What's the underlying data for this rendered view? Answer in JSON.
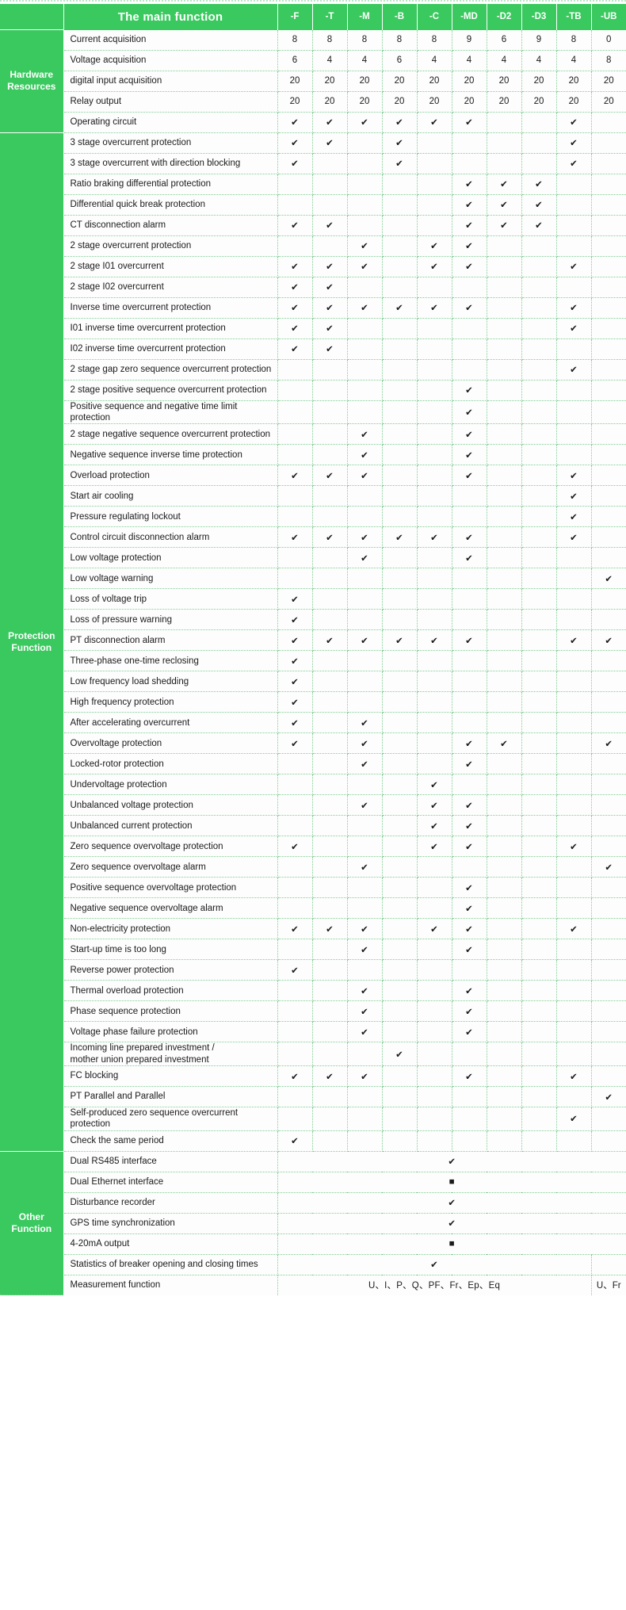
{
  "header": {
    "title": "The main function",
    "models": [
      "-F",
      "-T",
      "-M",
      "-B",
      "-C",
      "-MD",
      "-D2",
      "-D3",
      "-TB",
      "-UB"
    ]
  },
  "glyphs": {
    "check": "✔",
    "square": "■",
    "empty": ""
  },
  "groups": [
    {
      "label": "Hardware\nResources",
      "rows": [
        {
          "name": "Current acquisition",
          "values": [
            "8",
            "8",
            "8",
            "8",
            "8",
            "9",
            "6",
            "9",
            "8",
            "0"
          ]
        },
        {
          "name": "Voltage acquisition",
          "values": [
            "6",
            "4",
            "4",
            "6",
            "4",
            "4",
            "4",
            "4",
            "4",
            "8"
          ]
        },
        {
          "name": "digital input acquisition",
          "values": [
            "20",
            "20",
            "20",
            "20",
            "20",
            "20",
            "20",
            "20",
            "20",
            "20"
          ]
        },
        {
          "name": "Relay output",
          "values": [
            "20",
            "20",
            "20",
            "20",
            "20",
            "20",
            "20",
            "20",
            "20",
            "20"
          ]
        },
        {
          "name": "Operating circuit",
          "values": [
            "✔",
            "✔",
            "✔",
            "✔",
            "✔",
            "✔",
            "",
            "",
            "✔",
            ""
          ]
        }
      ]
    },
    {
      "label": "Protection\nFunction",
      "rows": [
        {
          "name": "3 stage overcurrent protection",
          "values": [
            "✔",
            "✔",
            "",
            "✔",
            "",
            "",
            "",
            "",
            "✔",
            ""
          ]
        },
        {
          "name": "3 stage overcurrent with direction blocking",
          "values": [
            "✔",
            "",
            "",
            "✔",
            "",
            "",
            "",
            "",
            "✔",
            ""
          ]
        },
        {
          "name": "Ratio braking differential protection",
          "values": [
            "",
            "",
            "",
            "",
            "",
            "✔",
            "✔",
            "✔",
            "",
            ""
          ]
        },
        {
          "name": "Differential quick break protection",
          "values": [
            "",
            "",
            "",
            "",
            "",
            "✔",
            "✔",
            "✔",
            "",
            ""
          ]
        },
        {
          "name": "CT disconnection alarm",
          "values": [
            "✔",
            "✔",
            "",
            "",
            "",
            "✔",
            "✔",
            "✔",
            "",
            ""
          ]
        },
        {
          "name": "2 stage overcurrent protection",
          "values": [
            "",
            "",
            "✔",
            "",
            "✔",
            "✔",
            "",
            "",
            "",
            ""
          ]
        },
        {
          "name": "2 stage I01  overcurrent",
          "values": [
            "✔",
            "✔",
            "✔",
            "",
            "✔",
            "✔",
            "",
            "",
            "✔",
            ""
          ]
        },
        {
          "name": "2 stage I02 overcurrent",
          "values": [
            "✔",
            "✔",
            "",
            "",
            "",
            "",
            "",
            "",
            "",
            ""
          ]
        },
        {
          "name": "Inverse time overcurrent protection",
          "values": [
            "✔",
            "✔",
            "✔",
            "✔",
            "✔",
            "✔",
            "",
            "",
            "✔",
            ""
          ]
        },
        {
          "name": "I01 inverse time overcurrent protection",
          "values": [
            "✔",
            "✔",
            "",
            "",
            "",
            "",
            "",
            "",
            "✔",
            ""
          ]
        },
        {
          "name": "I02 inverse time overcurrent protection",
          "values": [
            "✔",
            "✔",
            "",
            "",
            "",
            "",
            "",
            "",
            "",
            ""
          ]
        },
        {
          "name": "2 stage gap zero sequence overcurrent protection",
          "values": [
            "",
            "",
            "",
            "",
            "",
            "",
            "",
            "",
            "✔",
            ""
          ]
        },
        {
          "name": "2 stage positive sequence overcurrent protection",
          "values": [
            "",
            "",
            "",
            "",
            "",
            "✔",
            "",
            "",
            "",
            ""
          ]
        },
        {
          "name": "Positive sequence and negative time limit protection",
          "values": [
            "",
            "",
            "",
            "",
            "",
            "✔",
            "",
            "",
            "",
            ""
          ]
        },
        {
          "name": "2 stage negative sequence overcurrent protection",
          "values": [
            "",
            "",
            "✔",
            "",
            "",
            "✔",
            "",
            "",
            "",
            ""
          ]
        },
        {
          "name": "Negative sequence inverse time protection",
          "values": [
            "",
            "",
            "✔",
            "",
            "",
            "✔",
            "",
            "",
            "",
            ""
          ]
        },
        {
          "name": "Overload protection",
          "values": [
            "✔",
            "✔",
            "✔",
            "",
            "",
            "✔",
            "",
            "",
            "✔",
            ""
          ]
        },
        {
          "name": "Start air cooling",
          "values": [
            "",
            "",
            "",
            "",
            "",
            "",
            "",
            "",
            "✔",
            ""
          ]
        },
        {
          "name": "Pressure regulating lockout",
          "values": [
            "",
            "",
            "",
            "",
            "",
            "",
            "",
            "",
            "✔",
            ""
          ]
        },
        {
          "name": "Control circuit disconnection alarm",
          "values": [
            "✔",
            "✔",
            "✔",
            "✔",
            "✔",
            "✔",
            "",
            "",
            "✔",
            ""
          ]
        },
        {
          "name": "Low voltage protection",
          "values": [
            "",
            "",
            "✔",
            "",
            "",
            "✔",
            "",
            "",
            "",
            ""
          ]
        },
        {
          "name": "Low voltage warning",
          "values": [
            "",
            "",
            "",
            "",
            "",
            "",
            "",
            "",
            "",
            "✔"
          ]
        },
        {
          "name": "Loss of voltage trip",
          "values": [
            "✔",
            "",
            "",
            "",
            "",
            "",
            "",
            "",
            "",
            ""
          ]
        },
        {
          "name": "Loss of pressure warning",
          "values": [
            "✔",
            "",
            "",
            "",
            "",
            "",
            "",
            "",
            "",
            ""
          ]
        },
        {
          "name": "PT disconnection alarm",
          "values": [
            "✔",
            "✔",
            "✔",
            "✔",
            "✔",
            "✔",
            "",
            "",
            "✔",
            "✔"
          ]
        },
        {
          "name": "Three-phase one-time reclosing",
          "values": [
            "✔",
            "",
            "",
            "",
            "",
            "",
            "",
            "",
            "",
            ""
          ]
        },
        {
          "name": "Low frequency load shedding",
          "values": [
            "✔",
            "",
            "",
            "",
            "",
            "",
            "",
            "",
            "",
            ""
          ]
        },
        {
          "name": "High frequency protection",
          "values": [
            "✔",
            "",
            "",
            "",
            "",
            "",
            "",
            "",
            "",
            ""
          ]
        },
        {
          "name": "After accelerating overcurrent",
          "values": [
            "✔",
            "",
            "✔",
            "",
            "",
            "",
            "",
            "",
            "",
            ""
          ]
        },
        {
          "name": "Overvoltage protection",
          "values": [
            "✔",
            "",
            "✔",
            "",
            "",
            "✔",
            "✔",
            "",
            "",
            "✔"
          ]
        },
        {
          "name": "Locked-rotor protection",
          "values": [
            "",
            "",
            "✔",
            "",
            "",
            "✔",
            "",
            "",
            "",
            ""
          ]
        },
        {
          "name": "Undervoltage protection",
          "values": [
            "",
            "",
            "",
            "",
            "✔",
            "",
            "",
            "",
            "",
            ""
          ]
        },
        {
          "name": "Unbalanced voltage protection",
          "values": [
            "",
            "",
            "✔",
            "",
            "✔",
            "✔",
            "",
            "",
            "",
            ""
          ]
        },
        {
          "name": "Unbalanced current protection",
          "values": [
            "",
            "",
            "",
            "",
            "✔",
            "✔",
            "",
            "",
            "",
            ""
          ]
        },
        {
          "name": "Zero sequence overvoltage protection",
          "values": [
            "✔",
            "",
            "",
            "",
            "✔",
            "✔",
            "",
            "",
            "✔",
            ""
          ]
        },
        {
          "name": "Zero sequence overvoltage alarm",
          "values": [
            "",
            "",
            "✔",
            "",
            "",
            "",
            "",
            "",
            "",
            "✔"
          ]
        },
        {
          "name": "Positive sequence overvoltage protection",
          "values": [
            "",
            "",
            "",
            "",
            "",
            "✔",
            "",
            "",
            "",
            ""
          ]
        },
        {
          "name": "Negative sequence overvoltage alarm",
          "values": [
            "",
            "",
            "",
            "",
            "",
            "✔",
            "",
            "",
            "",
            ""
          ]
        },
        {
          "name": "Non-electricity protection",
          "values": [
            "✔",
            "✔",
            "✔",
            "",
            "✔",
            "✔",
            "",
            "",
            "✔",
            ""
          ]
        },
        {
          "name": "Start-up time is too long",
          "values": [
            "",
            "",
            "✔",
            "",
            "",
            "✔",
            "",
            "",
            "",
            ""
          ]
        },
        {
          "name": "Reverse power protection",
          "values": [
            "✔",
            "",
            "",
            "",
            "",
            "",
            "",
            "",
            "",
            ""
          ]
        },
        {
          "name": "Thermal overload protection",
          "values": [
            "",
            "",
            "✔",
            "",
            "",
            "✔",
            "",
            "",
            "",
            ""
          ]
        },
        {
          "name": "Phase sequence protection",
          "values": [
            "",
            "",
            "✔",
            "",
            "",
            "✔",
            "",
            "",
            "",
            ""
          ]
        },
        {
          "name": "Voltage phase failure protection",
          "values": [
            "",
            "",
            "✔",
            "",
            "",
            "✔",
            "",
            "",
            "",
            ""
          ]
        },
        {
          "name": "Incoming line prepared investment /\nmother union prepared investment",
          "values": [
            "",
            "",
            "",
            "✔",
            "",
            "",
            "",
            "",
            "",
            ""
          ]
        },
        {
          "name": "FC blocking",
          "values": [
            "✔",
            "✔",
            "✔",
            "",
            "",
            "✔",
            "",
            "",
            "✔",
            ""
          ]
        },
        {
          "name": "PT Parallel and Parallel",
          "values": [
            "",
            "",
            "",
            "",
            "",
            "",
            "",
            "",
            "",
            "✔"
          ]
        },
        {
          "name": "Self-produced zero sequence overcurrent protection",
          "values": [
            "",
            "",
            "",
            "",
            "",
            "",
            "",
            "",
            "✔",
            ""
          ]
        },
        {
          "name": "Check the same period",
          "values": [
            "✔",
            "",
            "",
            "",
            "",
            "",
            "",
            "",
            "",
            ""
          ]
        }
      ]
    },
    {
      "label": "Other\nFunction",
      "rows": [
        {
          "name": "Dual RS485 interface",
          "span": true,
          "span_value": "✔"
        },
        {
          "name": "Dual Ethernet interface",
          "span": true,
          "span_value": "■"
        },
        {
          "name": "Disturbance recorder",
          "span": true,
          "span_value": "✔"
        },
        {
          "name": "GPS time synchronization",
          "span": true,
          "span_value": "✔"
        },
        {
          "name": "4-20mA output",
          "span": true,
          "span_value": "■"
        },
        {
          "name": "Statistics of breaker opening and closing times",
          "span_split": true,
          "span_value": "✔",
          "tail_value": ""
        },
        {
          "name": "Measurement function",
          "span_split": true,
          "span_value": "U、I、P、Q、PF、Fr、Ep、Eq",
          "tail_value": "U、Fr"
        }
      ]
    }
  ]
}
